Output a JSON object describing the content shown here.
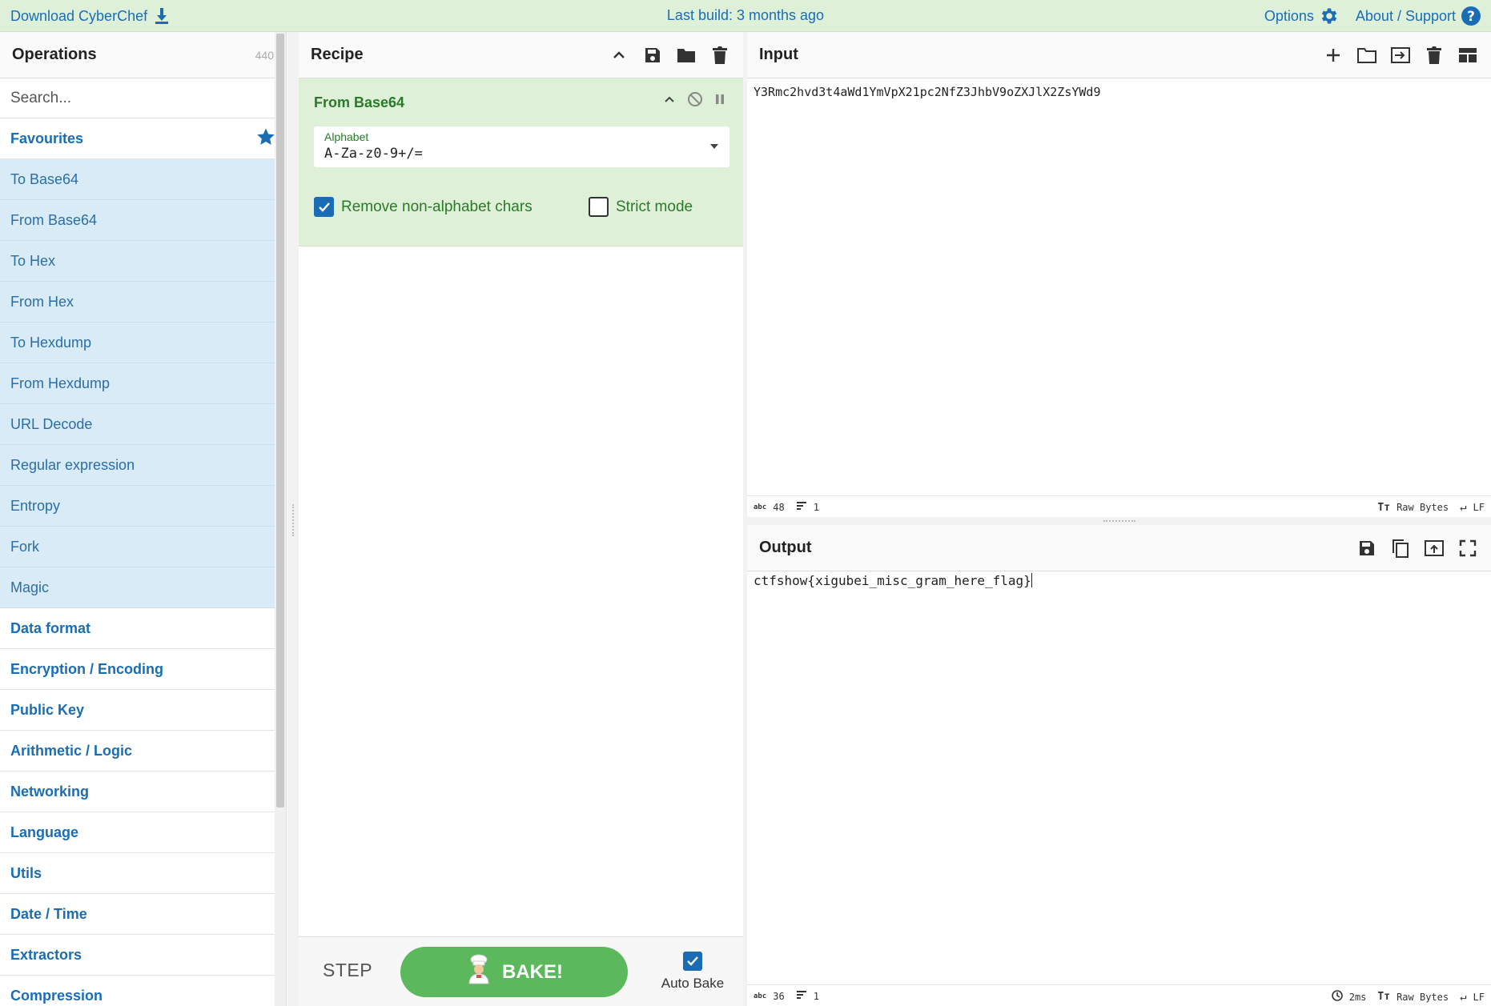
{
  "banner": {
    "download": "Download CyberChef",
    "last_build": "Last build: 3 months ago",
    "options": "Options",
    "about": "About / Support"
  },
  "operations": {
    "title": "Operations",
    "count": "440",
    "search_placeholder": "Search...",
    "favourites_label": "Favourites",
    "favourites": [
      "To Base64",
      "From Base64",
      "To Hex",
      "From Hex",
      "To Hexdump",
      "From Hexdump",
      "URL Decode",
      "Regular expression",
      "Entropy",
      "Fork",
      "Magic"
    ],
    "categories": [
      "Data format",
      "Encryption / Encoding",
      "Public Key",
      "Arithmetic / Logic",
      "Networking",
      "Language",
      "Utils",
      "Date / Time",
      "Extractors",
      "Compression"
    ]
  },
  "recipe": {
    "title": "Recipe",
    "operation": {
      "name": "From Base64",
      "alphabet_label": "Alphabet",
      "alphabet_value": "A-Za-z0-9+/=",
      "remove_non_alpha_label": "Remove non-alphabet chars",
      "remove_non_alpha_checked": true,
      "strict_mode_label": "Strict mode",
      "strict_mode_checked": false
    },
    "step_label": "STEP",
    "bake_label": "BAKE!",
    "auto_bake_label": "Auto Bake",
    "auto_bake_checked": true
  },
  "input": {
    "title": "Input",
    "text": "Y3Rmc2hvd3t4aWd1YmVpX21pc2NfZ3JhbV9oZXJlX2ZsYWd9",
    "length": "48",
    "lines": "1",
    "encoding": "Raw Bytes",
    "eol": "LF"
  },
  "output": {
    "title": "Output",
    "text": "ctfshow{xigubei_misc_gram_here_flag}",
    "length": "36",
    "lines": "1",
    "time": "2ms",
    "encoding": "Raw Bytes",
    "eol": "LF"
  },
  "colors": {
    "banner_bg": "#dff0d8",
    "link": "#1a6db5",
    "favourite_bg": "#d9ebf7",
    "recipe_card_bg": "#dff0d8",
    "bake_green": "#5cb85c"
  }
}
